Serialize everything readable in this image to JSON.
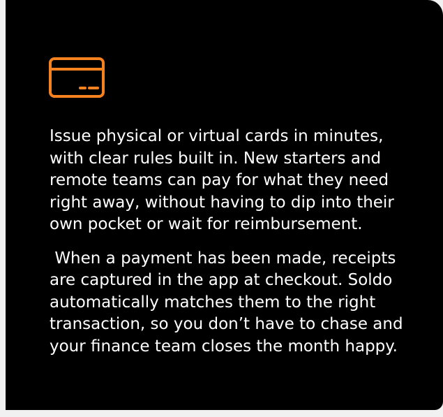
{
  "card": {
    "icon": "credit-card-icon",
    "accent_color": "#f5821f",
    "background_color": "#000000",
    "paragraphs": [
      "Issue physical or virtual cards in minutes, with clear rules built in. New starters and remote teams can pay for what they need right away, without having to dip into their own pocket or wait for reimbursement.",
      " When a payment has been made, receipts are captured in the app at checkout. Soldo automatically matches them to the right transaction, so you don’t have to chase and your finance team closes the month happy."
    ]
  }
}
